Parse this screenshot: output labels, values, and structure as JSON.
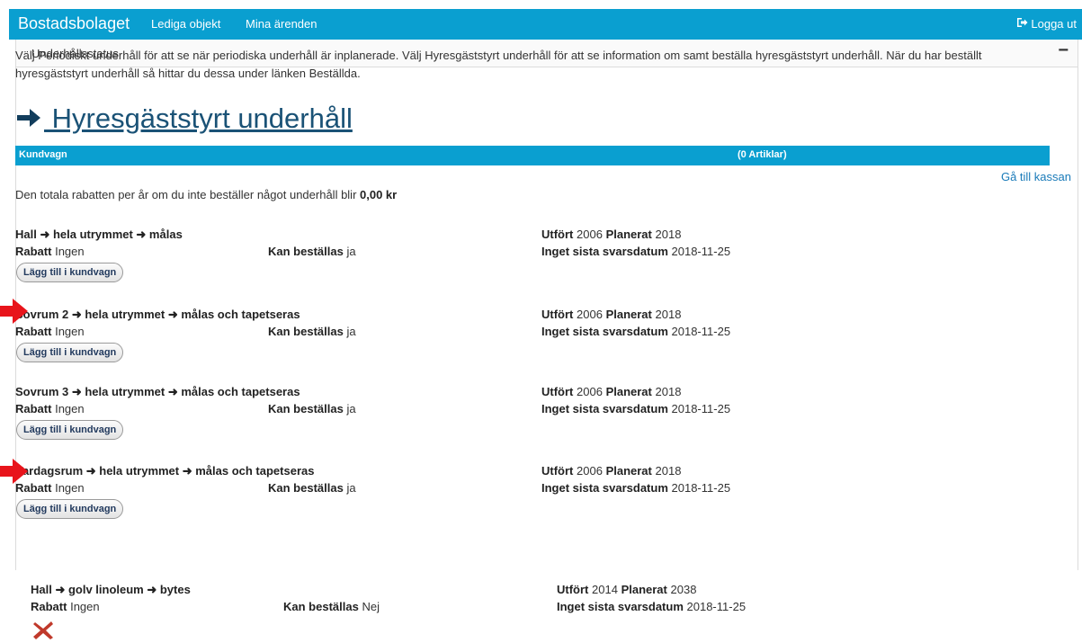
{
  "navbar": {
    "brand": "Bostadsbolaget",
    "links": [
      "Lediga objekt",
      "Mina ärenden"
    ],
    "logout": "Logga ut",
    "logout_icon": "logout-icon"
  },
  "panel": {
    "title": "Underhållsstatus",
    "collapse": "−"
  },
  "intro": "Välj Periodiskt underhåll för att se när periodiska underhåll är inplanerade. Välj Hyresgäststyrt underhåll för att se information om samt beställa hyresgäststyrt underhåll. När du har beställt hyresgäststyrt underhåll så hittar du dessa under länken Beställda.",
  "section": {
    "title": " Hyresgäststyrt underhåll",
    "icon": "arrow-right-icon"
  },
  "cart": {
    "label": "Kundvagn",
    "count": "(0 Artiklar)",
    "checkout": "Gå till kassan"
  },
  "discount": {
    "text": "Den totala rabatten per år om du inte beställer något underhåll blir ",
    "amount": "0,00 kr"
  },
  "labels": {
    "rabatt": "Rabatt",
    "kan": "Kan beställas",
    "utfort": "Utfört",
    "planerat": "Planerat",
    "inget": "Inget sista svarsdatum",
    "add": "Lägg till i kundvagn"
  },
  "items": [
    {
      "title": "Hall ➜ hela utrymmet ➜ målas",
      "rabatt": "Ingen",
      "kan": "ja",
      "utfort": "2006",
      "planerat": "2018",
      "datum": "2018-11-25"
    },
    {
      "title": "Sovrum 2 ➜ hela utrymmet ➜ målas och tapetseras",
      "rabatt": "Ingen",
      "kan": "ja",
      "utfort": "2006",
      "planerat": "2018",
      "datum": "2018-11-25"
    },
    {
      "title": "Sovrum 3 ➜ hela utrymmet ➜ målas och tapetseras",
      "rabatt": "Ingen",
      "kan": "ja",
      "utfort": "2006",
      "planerat": "2018",
      "datum": "2018-11-25"
    },
    {
      "title": "Vardagsrum ➜ hela utrymmet ➜ målas och tapetseras",
      "rabatt": "Ingen",
      "kan": "ja",
      "utfort": "2006",
      "planerat": "2018",
      "datum": "2018-11-25"
    },
    {
      "title": "Hall ➜ golv linoleum ➜ bytes",
      "rabatt": "Ingen",
      "kan": "Nej",
      "utfort": "2014",
      "planerat": "2038",
      "datum": "2018-11-25"
    }
  ],
  "colors": {
    "navbar": "#0a9fd0",
    "link": "#1a7bb9",
    "heading": "#1a5276",
    "arrow_annotation": "#e8141b",
    "not_orderable": "#c0392b"
  }
}
